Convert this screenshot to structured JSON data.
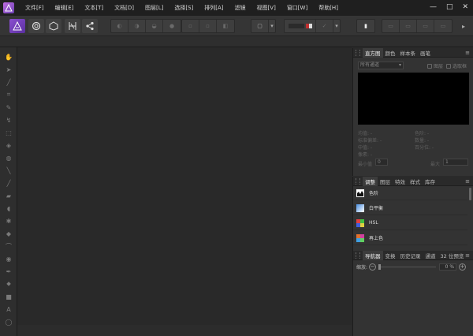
{
  "menu": {
    "items": [
      "文件[F]",
      "编辑[E]",
      "文本[T]",
      "文档[D]",
      "图层[L]",
      "选择[S]",
      "排列[A]",
      "滤镜",
      "视图[V]",
      "窗口[W]",
      "帮助[H]"
    ]
  },
  "window_controls": {
    "minimize": "—",
    "maximize": "□",
    "close": "✕"
  },
  "histogram_panel": {
    "tabs": [
      "直方图",
      "颜色",
      "样本条",
      "画笔"
    ],
    "channel_select": "所有通道",
    "layer_checkbox": "图层",
    "selection_checkbox": "选取框",
    "stats_left": [
      "均值: -",
      "标准偏差: -",
      "中值: -",
      "像素: -"
    ],
    "stats_right": [
      "色阶: -",
      "数量: -",
      "百分位: -"
    ],
    "min_label": "最小值",
    "min_value": "0",
    "max_label": "最大",
    "max_value": "1"
  },
  "adjustment_panel": {
    "tabs": [
      "调整",
      "图层",
      "特效",
      "样式",
      "库存"
    ],
    "items": [
      "色阶",
      "白平衡",
      "HSL",
      "再上色"
    ]
  },
  "navigator_panel": {
    "tabs": [
      "导航器",
      "变换",
      "历史记录",
      "通道",
      "32 位预览"
    ],
    "zoom_label": "缩放:",
    "zoom_value": "0 %"
  },
  "colors": {
    "accent_purple": "#8b4fd0",
    "background": "#2b2b2b",
    "canvas": "#292929",
    "histogram_bg": "#000000"
  }
}
